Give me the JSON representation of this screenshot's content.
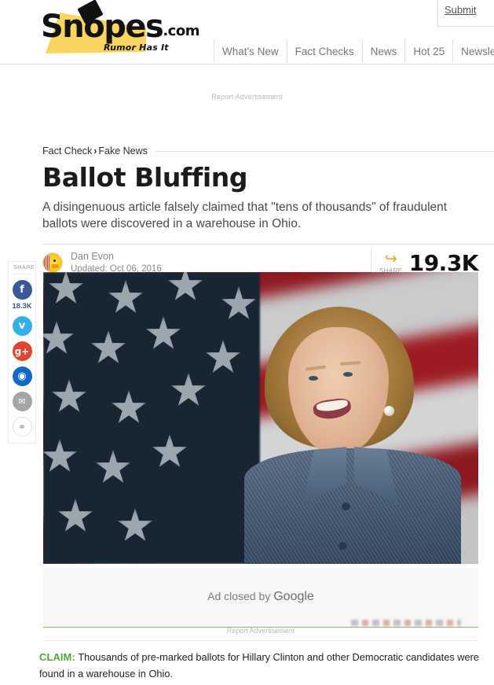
{
  "site": {
    "logo_text": "Snopes",
    "logo_suffix": ".com",
    "tagline": "Rumor Has It",
    "submit_label": "Submit"
  },
  "nav": {
    "items": [
      {
        "label": "What's New"
      },
      {
        "label": "Fact Checks"
      },
      {
        "label": "News"
      },
      {
        "label": "Hot 25"
      },
      {
        "label": "Newsletter"
      }
    ]
  },
  "ads": {
    "report_top": "Report Advertisement",
    "report_bottom": "Report Advertisement",
    "closed_prefix": "Ad closed by ",
    "closed_brand": "Google"
  },
  "article": {
    "breadcrumb_parent": "Fact Check",
    "breadcrumb_sep": "›",
    "breadcrumb_child": "Fake News",
    "headline": "Ballot Bluffing",
    "subhead": "A disingenuous article falsely claimed that \"tens of thousands\" of fraudulent ballots were discovered in a warehouse in Ohio.",
    "author": "Dan Evon",
    "updated": "Updated: Oct 06, 2016",
    "share_word": "SHARE",
    "share_arrow_glyph": "↪",
    "share_count": "19.3K",
    "claim_label": "CLAIM:",
    "claim_text": "Thousands of pre-marked ballots for Hillary Clinton and other Democratic candidates were found in a warehouse in Ohio."
  },
  "share_rail": {
    "title": "SHARE",
    "facebook_count": "18.3K",
    "buttons": [
      {
        "name": "facebook",
        "glyph": "f",
        "color": "#3b5998"
      },
      {
        "name": "twitter",
        "glyph": "ᴠ",
        "color": "#34b0e8"
      },
      {
        "name": "google-plus",
        "glyph": "g+",
        "color": "#e0452f"
      },
      {
        "name": "reddit",
        "glyph": "◉",
        "color": "#1268c3"
      },
      {
        "name": "email",
        "glyph": "✉",
        "color": "#a3a5a7"
      },
      {
        "name": "link",
        "glyph": "⚭",
        "color": "#ffffff"
      }
    ]
  },
  "hero": {
    "alt": "Hillary Clinton smiling in front of a blurred American flag"
  },
  "colors": {
    "accent_green": "#4fa533",
    "share_gold": "#e5a82e",
    "facebook_blue": "#3b5998",
    "logo_yellow": "#f7d560"
  }
}
